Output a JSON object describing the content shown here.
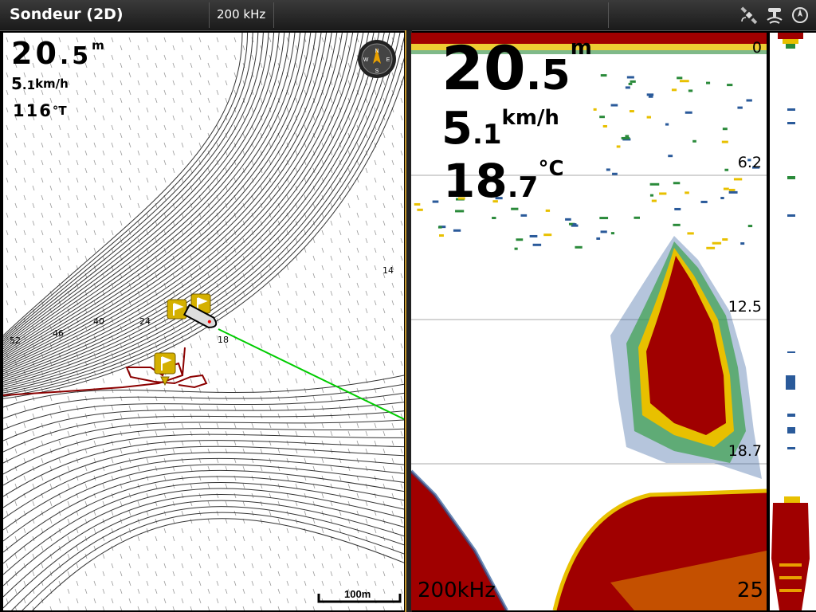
{
  "topbar": {
    "title": "Sondeur (2D)",
    "frequency": "200 kHz",
    "icons": [
      "satellite-icon",
      "sonar-transducer-icon",
      "compass-status-icon"
    ]
  },
  "chart": {
    "depth_int": "20",
    "depth_dec": ".5",
    "depth_unit": "m",
    "speed_int": "5",
    "speed_dec": ".1",
    "speed_unit": "km/h",
    "heading": "116",
    "heading_unit": "°T",
    "contour_labels": [
      "52",
      "46",
      "40",
      "24",
      "18",
      "14"
    ],
    "scale_label": "100m",
    "compass_letters": [
      "N",
      "E",
      "S",
      "W"
    ]
  },
  "sonar": {
    "depth_int": "20",
    "depth_dec": ".5",
    "depth_unit": "m",
    "speed_int": "5",
    "speed_dec": ".1",
    "speed_unit": "km/h",
    "temp_int": "18",
    "temp_dec": ".7",
    "temp_unit": "°C",
    "frequency_label": "200kHz",
    "range_label": "25",
    "scale_labels": [
      "0",
      "6.2",
      "12.5",
      "18.7"
    ]
  },
  "colors": {
    "background": "#ffffff",
    "contour": "#333333",
    "track": "#8b0000",
    "heading_line": "#00cc00",
    "sonar_strong": "#a00000",
    "sonar_mid": "#e8c000",
    "sonar_weak": "#2a5a9a",
    "divider_accent": "#c89a30"
  }
}
